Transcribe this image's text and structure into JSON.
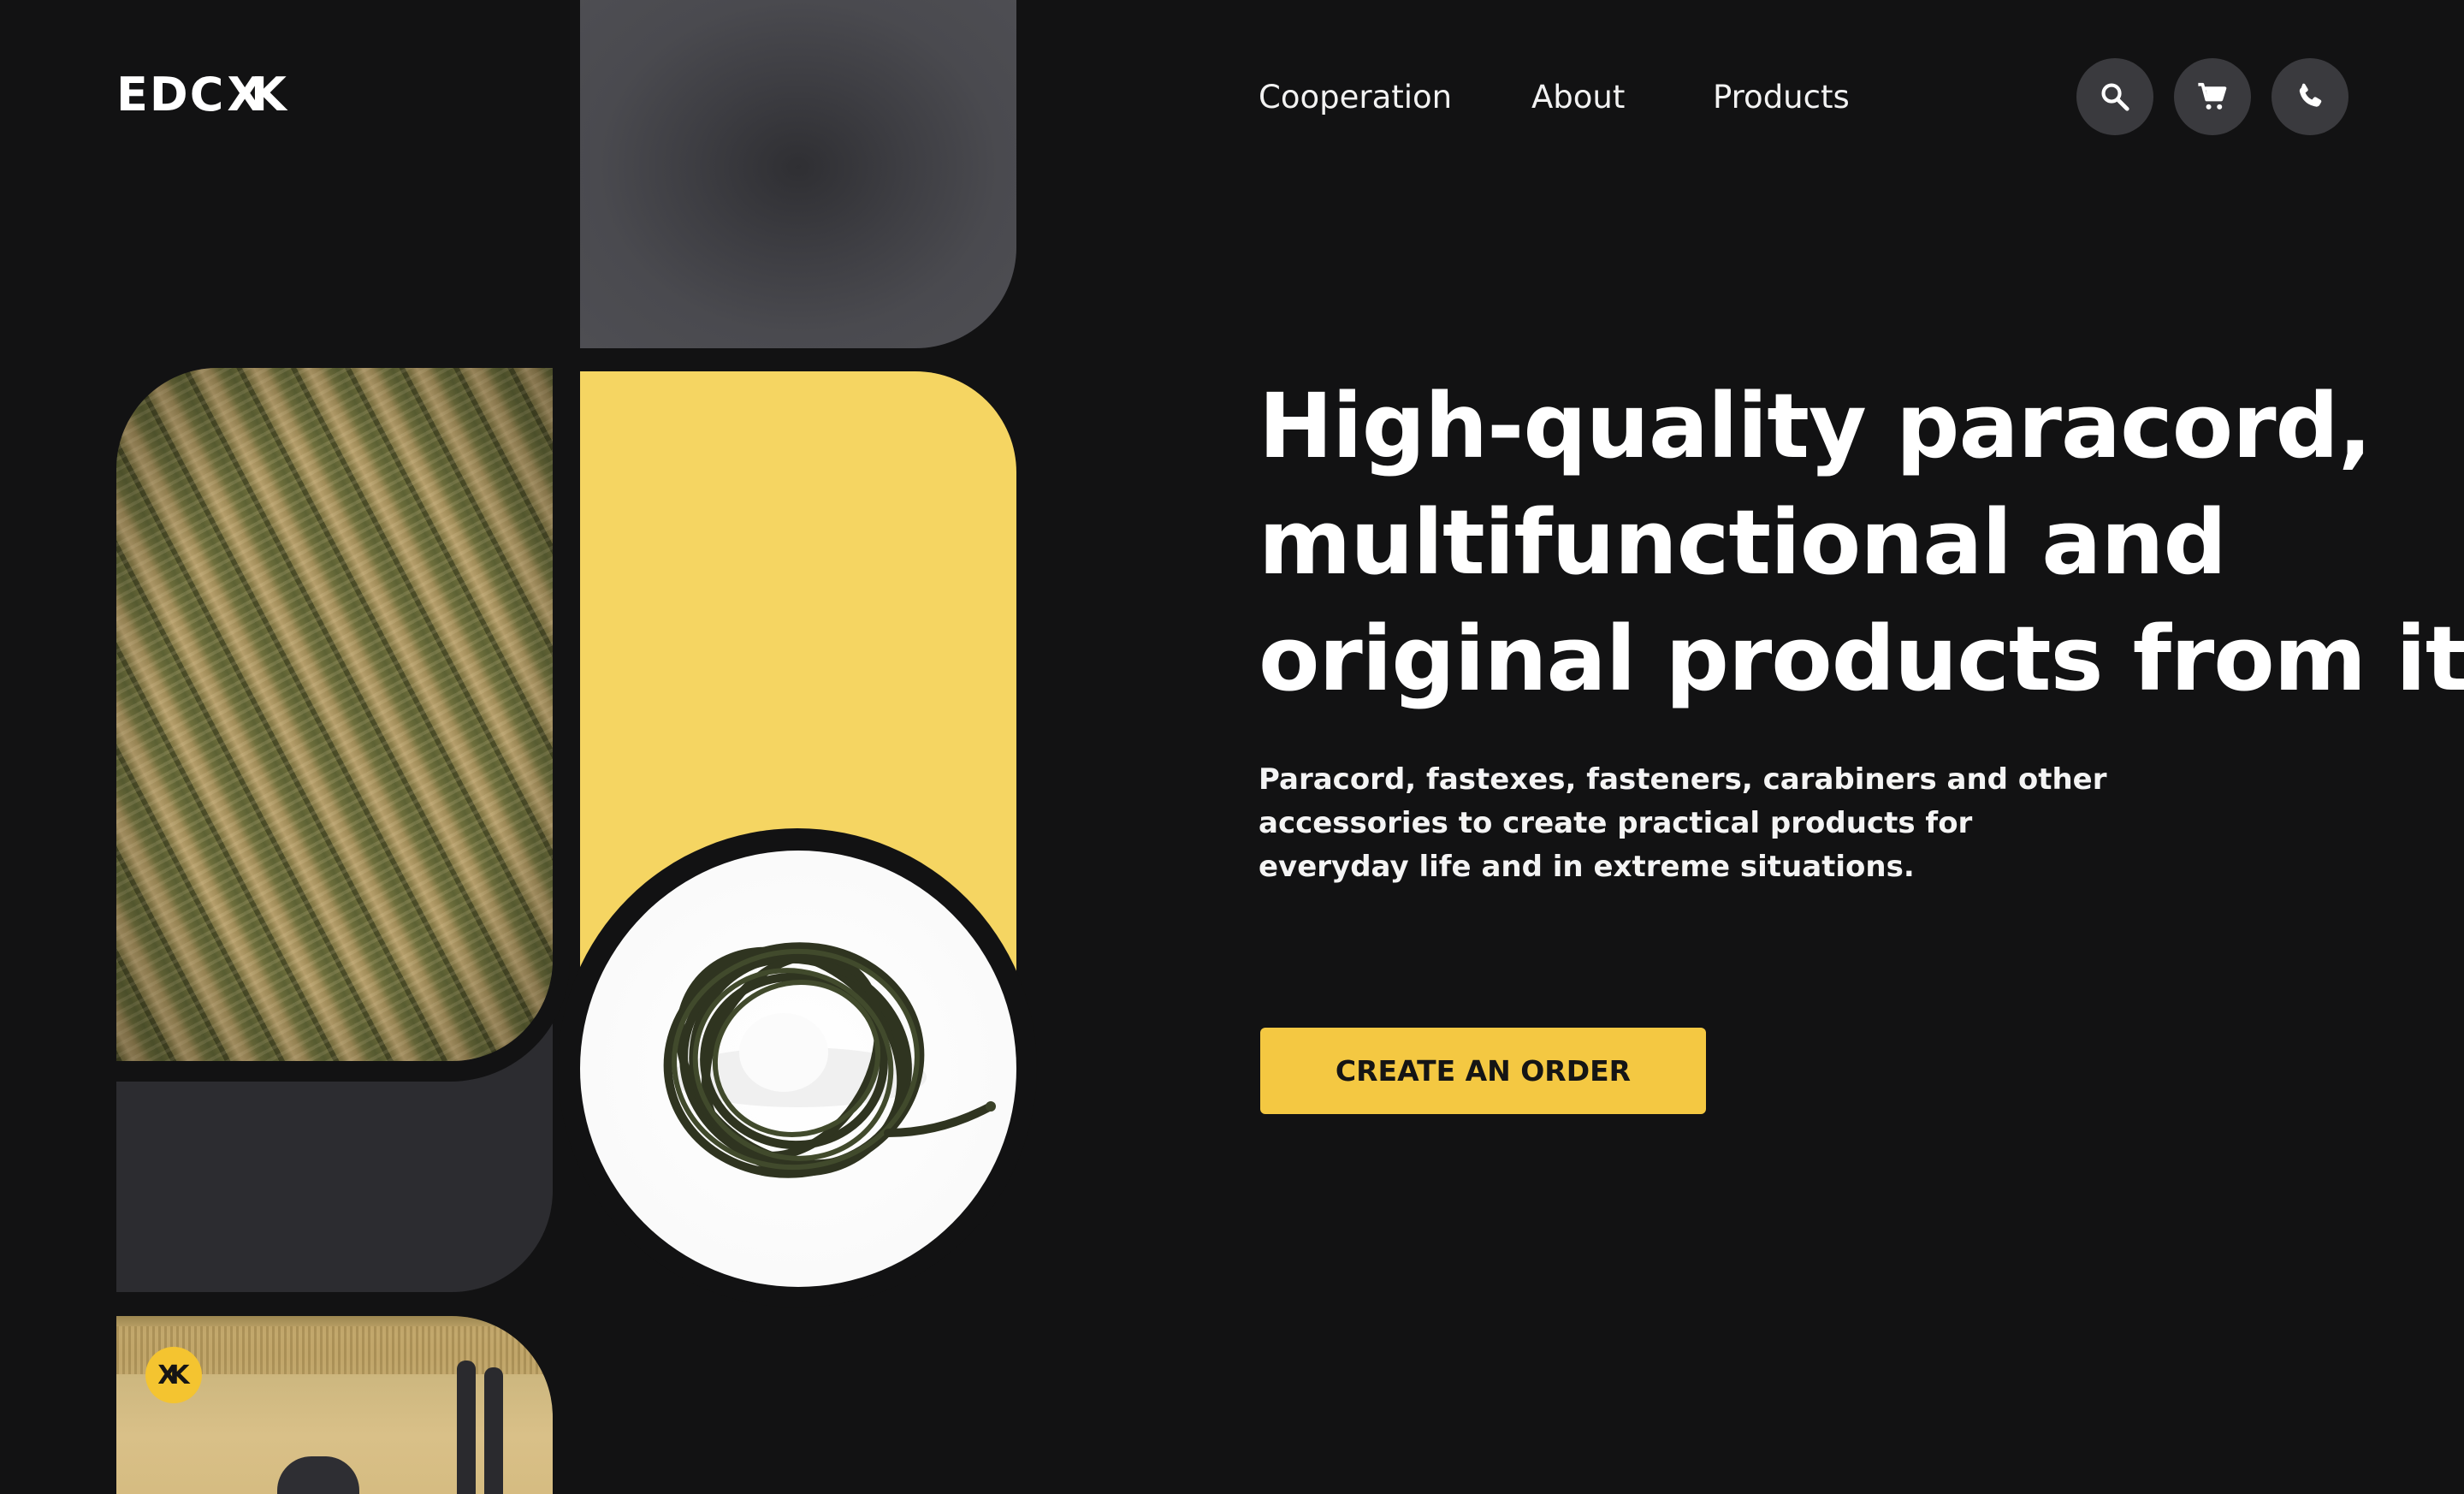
{
  "header": {
    "logo_text": "EDC",
    "logo_mark": "XK",
    "nav": [
      {
        "label": "Cooperation"
      },
      {
        "label": "About"
      },
      {
        "label": "Products"
      }
    ],
    "icons": [
      "search-icon",
      "cart-icon",
      "phone-icon"
    ]
  },
  "hero": {
    "title_lines": [
      "High-quality paracord,",
      "multifunctional and",
      "original products from it"
    ],
    "subtitle_lines": [
      "Paracord, fastexes, fasteners, carabiners and other",
      "accessories to create practical products for",
      "everyday life and in extreme situations."
    ],
    "cta_label": "CREATE AN ORDER"
  },
  "collage": {
    "badge_mark": "XK"
  },
  "colors": {
    "background": "#121213",
    "accent_yellow": "#f5d562",
    "button_yellow": "#f4c842",
    "icon_button_bg": "#3a3a3e",
    "tile_gray": "#4a4a4f",
    "tile_dark": "#2c2c30"
  }
}
